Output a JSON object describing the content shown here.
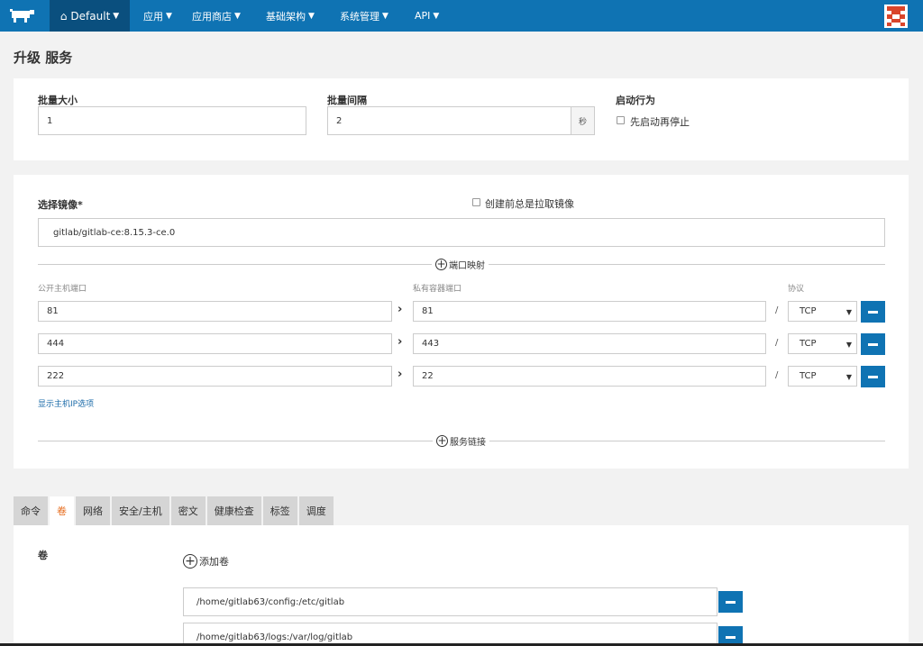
{
  "nav": {
    "env_label": "Default",
    "items": [
      {
        "label": "应用"
      },
      {
        "label": "应用商店"
      },
      {
        "label": "基础架构"
      },
      {
        "label": "系统管理"
      },
      {
        "label": "API"
      }
    ]
  },
  "page": {
    "title": "升级 服务"
  },
  "upgrade": {
    "batch_size_label": "批量大小",
    "batch_size_value": "1",
    "batch_interval_label": "批量间隔",
    "batch_interval_value": "2",
    "interval_unit": "秒",
    "start_behavior_label": "启动行为",
    "start_first_label": "先启动再停止"
  },
  "image": {
    "label": "选择镜像*",
    "always_pull_label": "创建前总是拉取镜像",
    "value": "gitlab/gitlab-ce:8.15.3-ce.0"
  },
  "ports": {
    "section_label": "端口映射",
    "public_header": "公开主机端口",
    "private_header": "私有容器端口",
    "protocol_header": "协议",
    "rows": [
      {
        "public": "81",
        "private": "81",
        "protocol": "TCP"
      },
      {
        "public": "444",
        "private": "443",
        "protocol": "TCP"
      },
      {
        "public": "222",
        "private": "22",
        "protocol": "TCP"
      }
    ],
    "show_host_ip_link": "显示主机IP选项"
  },
  "links": {
    "section_label": "服务链接"
  },
  "tabs": [
    {
      "label": "命令"
    },
    {
      "label": "卷"
    },
    {
      "label": "网络"
    },
    {
      "label": "安全/主机"
    },
    {
      "label": "密文"
    },
    {
      "label": "健康检查"
    },
    {
      "label": "标签"
    },
    {
      "label": "调度"
    }
  ],
  "volumes": {
    "label": "卷",
    "add_label": "添加卷",
    "items": [
      {
        "value": "/home/gitlab63/config:/etc/gitlab"
      },
      {
        "value": "/home/gitlab63/logs:/var/log/gitlab"
      }
    ]
  },
  "colors": {
    "brand": "#0f73b3",
    "brand_dark": "#0a4f7e",
    "active_tab": "#e66a1a"
  }
}
